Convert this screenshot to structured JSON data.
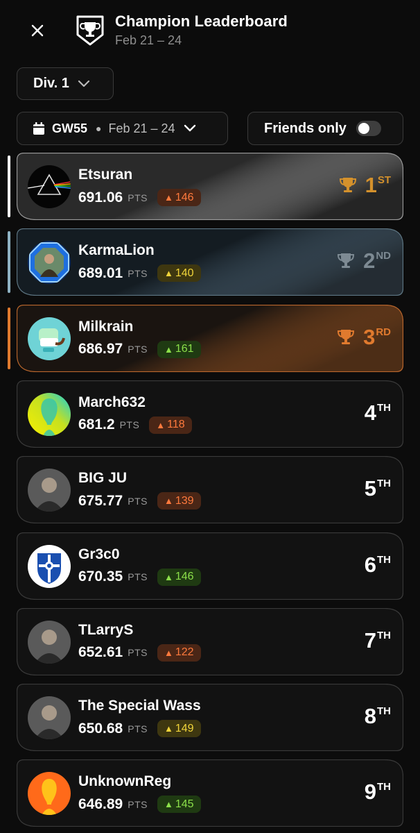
{
  "header": {
    "title": "Champion Leaderboard",
    "subtitle": "Feb 21 – 24"
  },
  "filters": {
    "division": "Div. 1",
    "gameweek": "GW55",
    "gameweek_dates": "Feb 21 – 24",
    "friends_only_label": "Friends only",
    "friends_only_on": false
  },
  "pts_unit": "PTS",
  "colors": {
    "gold": "#d4912c",
    "silver": "#7d8a93",
    "bronze": "#e07a2e",
    "delta_orange_bg": "#4a2616",
    "delta_orange_fg": "#ff7a3d",
    "delta_yellow_bg": "#3e3710",
    "delta_yellow_fg": "#f0d43a",
    "delta_green_bg": "#1f3a12",
    "delta_green_fg": "#8ce04a"
  },
  "leaderboard": [
    {
      "name": "Etsuran",
      "points": "691.06",
      "delta": "146",
      "delta_color": "orange",
      "rank": "1",
      "suffix": "ST",
      "trophy": "gold",
      "avatar": "prism-icon"
    },
    {
      "name": "KarmaLion",
      "points": "689.01",
      "delta": "140",
      "delta_color": "yellow",
      "rank": "2",
      "suffix": "ND",
      "trophy": "silver",
      "avatar": "octagon-portrait-icon"
    },
    {
      "name": "Milkrain",
      "points": "686.97",
      "delta": "161",
      "delta_color": "green",
      "rank": "3",
      "suffix": "RD",
      "trophy": "bronze",
      "avatar": "teeth-pipe-icon"
    },
    {
      "name": "March632",
      "points": "681.2",
      "delta": "118",
      "delta_color": "orange",
      "rank": "4",
      "suffix": "TH",
      "trophy": "",
      "avatar": "silhouette-gradient-icon"
    },
    {
      "name": "BIG JU",
      "points": "675.77",
      "delta": "139",
      "delta_color": "orange",
      "rank": "5",
      "suffix": "TH",
      "trophy": "",
      "avatar": "portrait-photo-icon"
    },
    {
      "name": "Gr3c0",
      "points": "670.35",
      "delta": "146",
      "delta_color": "green",
      "rank": "6",
      "suffix": "TH",
      "trophy": "",
      "avatar": "club-crest-icon"
    },
    {
      "name": "TLarryS",
      "points": "652.61",
      "delta": "122",
      "delta_color": "orange",
      "rank": "7",
      "suffix": "TH",
      "trophy": "",
      "avatar": "portrait-photo-icon"
    },
    {
      "name": "The Special Wass",
      "points": "650.68",
      "delta": "149",
      "delta_color": "yellow",
      "rank": "8",
      "suffix": "TH",
      "trophy": "",
      "avatar": "portrait-photo-icon"
    },
    {
      "name": "UnknownReg",
      "points": "646.89",
      "delta": "145",
      "delta_color": "green",
      "rank": "9",
      "suffix": "TH",
      "trophy": "",
      "avatar": "silhouette-orange-icon"
    }
  ]
}
